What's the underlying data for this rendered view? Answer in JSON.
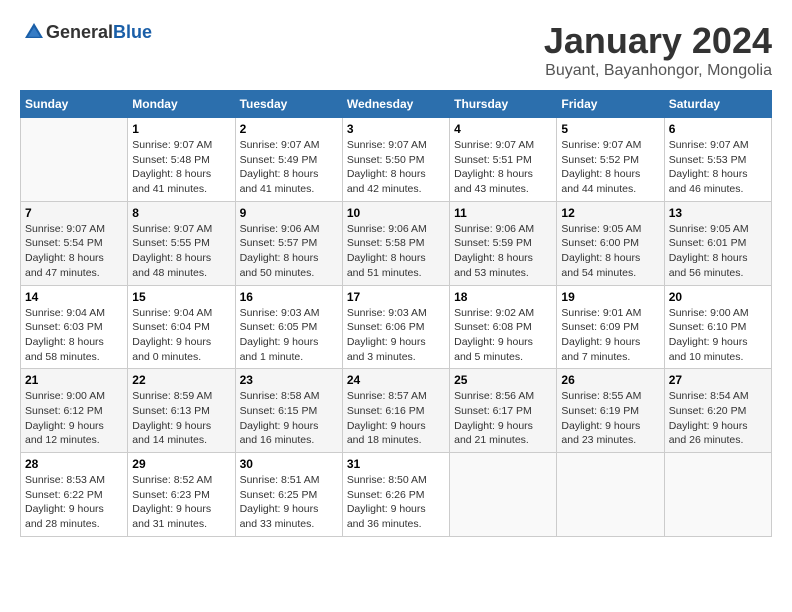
{
  "header": {
    "logo_general": "General",
    "logo_blue": "Blue",
    "month_title": "January 2024",
    "location": "Buyant, Bayanhongor, Mongolia"
  },
  "weekdays": [
    "Sunday",
    "Monday",
    "Tuesday",
    "Wednesday",
    "Thursday",
    "Friday",
    "Saturday"
  ],
  "weeks": [
    [
      {
        "day": "",
        "empty": true
      },
      {
        "day": "1",
        "sunrise": "9:07 AM",
        "sunset": "5:48 PM",
        "daylight": "8 hours and 41 minutes."
      },
      {
        "day": "2",
        "sunrise": "9:07 AM",
        "sunset": "5:49 PM",
        "daylight": "8 hours and 41 minutes."
      },
      {
        "day": "3",
        "sunrise": "9:07 AM",
        "sunset": "5:50 PM",
        "daylight": "8 hours and 42 minutes."
      },
      {
        "day": "4",
        "sunrise": "9:07 AM",
        "sunset": "5:51 PM",
        "daylight": "8 hours and 43 minutes."
      },
      {
        "day": "5",
        "sunrise": "9:07 AM",
        "sunset": "5:52 PM",
        "daylight": "8 hours and 44 minutes."
      },
      {
        "day": "6",
        "sunrise": "9:07 AM",
        "sunset": "5:53 PM",
        "daylight": "8 hours and 46 minutes."
      }
    ],
    [
      {
        "day": "7",
        "sunrise": "9:07 AM",
        "sunset": "5:54 PM",
        "daylight": "8 hours and 47 minutes."
      },
      {
        "day": "8",
        "sunrise": "9:07 AM",
        "sunset": "5:55 PM",
        "daylight": "8 hours and 48 minutes."
      },
      {
        "day": "9",
        "sunrise": "9:06 AM",
        "sunset": "5:57 PM",
        "daylight": "8 hours and 50 minutes."
      },
      {
        "day": "10",
        "sunrise": "9:06 AM",
        "sunset": "5:58 PM",
        "daylight": "8 hours and 51 minutes."
      },
      {
        "day": "11",
        "sunrise": "9:06 AM",
        "sunset": "5:59 PM",
        "daylight": "8 hours and 53 minutes."
      },
      {
        "day": "12",
        "sunrise": "9:05 AM",
        "sunset": "6:00 PM",
        "daylight": "8 hours and 54 minutes."
      },
      {
        "day": "13",
        "sunrise": "9:05 AM",
        "sunset": "6:01 PM",
        "daylight": "8 hours and 56 minutes."
      }
    ],
    [
      {
        "day": "14",
        "sunrise": "9:04 AM",
        "sunset": "6:03 PM",
        "daylight": "8 hours and 58 minutes."
      },
      {
        "day": "15",
        "sunrise": "9:04 AM",
        "sunset": "6:04 PM",
        "daylight": "9 hours and 0 minutes."
      },
      {
        "day": "16",
        "sunrise": "9:03 AM",
        "sunset": "6:05 PM",
        "daylight": "9 hours and 1 minute."
      },
      {
        "day": "17",
        "sunrise": "9:03 AM",
        "sunset": "6:06 PM",
        "daylight": "9 hours and 3 minutes."
      },
      {
        "day": "18",
        "sunrise": "9:02 AM",
        "sunset": "6:08 PM",
        "daylight": "9 hours and 5 minutes."
      },
      {
        "day": "19",
        "sunrise": "9:01 AM",
        "sunset": "6:09 PM",
        "daylight": "9 hours and 7 minutes."
      },
      {
        "day": "20",
        "sunrise": "9:00 AM",
        "sunset": "6:10 PM",
        "daylight": "9 hours and 10 minutes."
      }
    ],
    [
      {
        "day": "21",
        "sunrise": "9:00 AM",
        "sunset": "6:12 PM",
        "daylight": "9 hours and 12 minutes."
      },
      {
        "day": "22",
        "sunrise": "8:59 AM",
        "sunset": "6:13 PM",
        "daylight": "9 hours and 14 minutes."
      },
      {
        "day": "23",
        "sunrise": "8:58 AM",
        "sunset": "6:15 PM",
        "daylight": "9 hours and 16 minutes."
      },
      {
        "day": "24",
        "sunrise": "8:57 AM",
        "sunset": "6:16 PM",
        "daylight": "9 hours and 18 minutes."
      },
      {
        "day": "25",
        "sunrise": "8:56 AM",
        "sunset": "6:17 PM",
        "daylight": "9 hours and 21 minutes."
      },
      {
        "day": "26",
        "sunrise": "8:55 AM",
        "sunset": "6:19 PM",
        "daylight": "9 hours and 23 minutes."
      },
      {
        "day": "27",
        "sunrise": "8:54 AM",
        "sunset": "6:20 PM",
        "daylight": "9 hours and 26 minutes."
      }
    ],
    [
      {
        "day": "28",
        "sunrise": "8:53 AM",
        "sunset": "6:22 PM",
        "daylight": "9 hours and 28 minutes."
      },
      {
        "day": "29",
        "sunrise": "8:52 AM",
        "sunset": "6:23 PM",
        "daylight": "9 hours and 31 minutes."
      },
      {
        "day": "30",
        "sunrise": "8:51 AM",
        "sunset": "6:25 PM",
        "daylight": "9 hours and 33 minutes."
      },
      {
        "day": "31",
        "sunrise": "8:50 AM",
        "sunset": "6:26 PM",
        "daylight": "9 hours and 36 minutes."
      },
      {
        "day": "",
        "empty": true
      },
      {
        "day": "",
        "empty": true
      },
      {
        "day": "",
        "empty": true
      }
    ]
  ],
  "labels": {
    "sunrise": "Sunrise:",
    "sunset": "Sunset:",
    "daylight": "Daylight:"
  }
}
